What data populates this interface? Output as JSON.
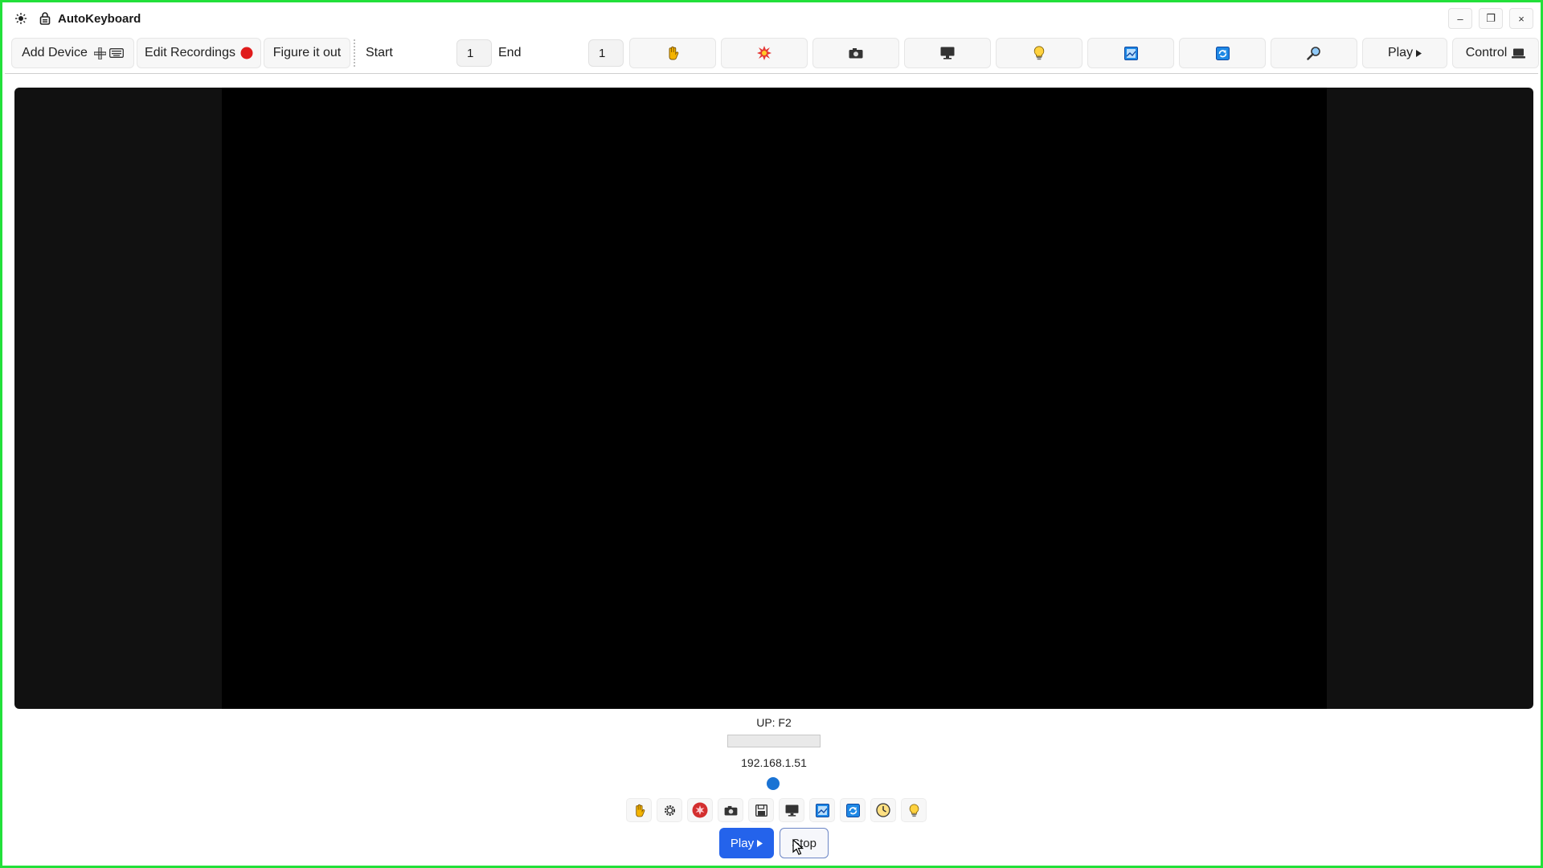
{
  "window": {
    "title": "AutoKeyboard",
    "controls": [
      "–",
      "❐",
      "×"
    ]
  },
  "toolbar": {
    "add_device_label": "Add Device",
    "edit_recordings_label": "Edit Recordings",
    "figure_it_out_label": "Figure it out",
    "start_label": "Start",
    "start_value": "1",
    "end_label": "End",
    "end_value": "1",
    "play_label": "Play",
    "control_label": "Control",
    "icon_buttons": [
      "hand-icon",
      "burst-icon",
      "camera-icon",
      "monitor-icon",
      "bulb-icon",
      "image-icon",
      "refresh-icon",
      "search-icon"
    ]
  },
  "status": {
    "key_text": "UP: F2",
    "progress": 0,
    "ip_address": "192.168.1.51"
  },
  "bottom_bar": {
    "icons": [
      "hand-icon",
      "gear-icon",
      "record-icon",
      "camera-icon",
      "save-icon",
      "monitor-icon",
      "image-icon",
      "refresh-icon",
      "clock-icon",
      "bulb-icon"
    ],
    "play_label": "Play",
    "stop_label": "Stop"
  },
  "colors": {
    "accent": "#2463eb",
    "frame_border": "#22e03a",
    "record_red": "#e01b1b",
    "status_dot": "#1a73d4"
  }
}
